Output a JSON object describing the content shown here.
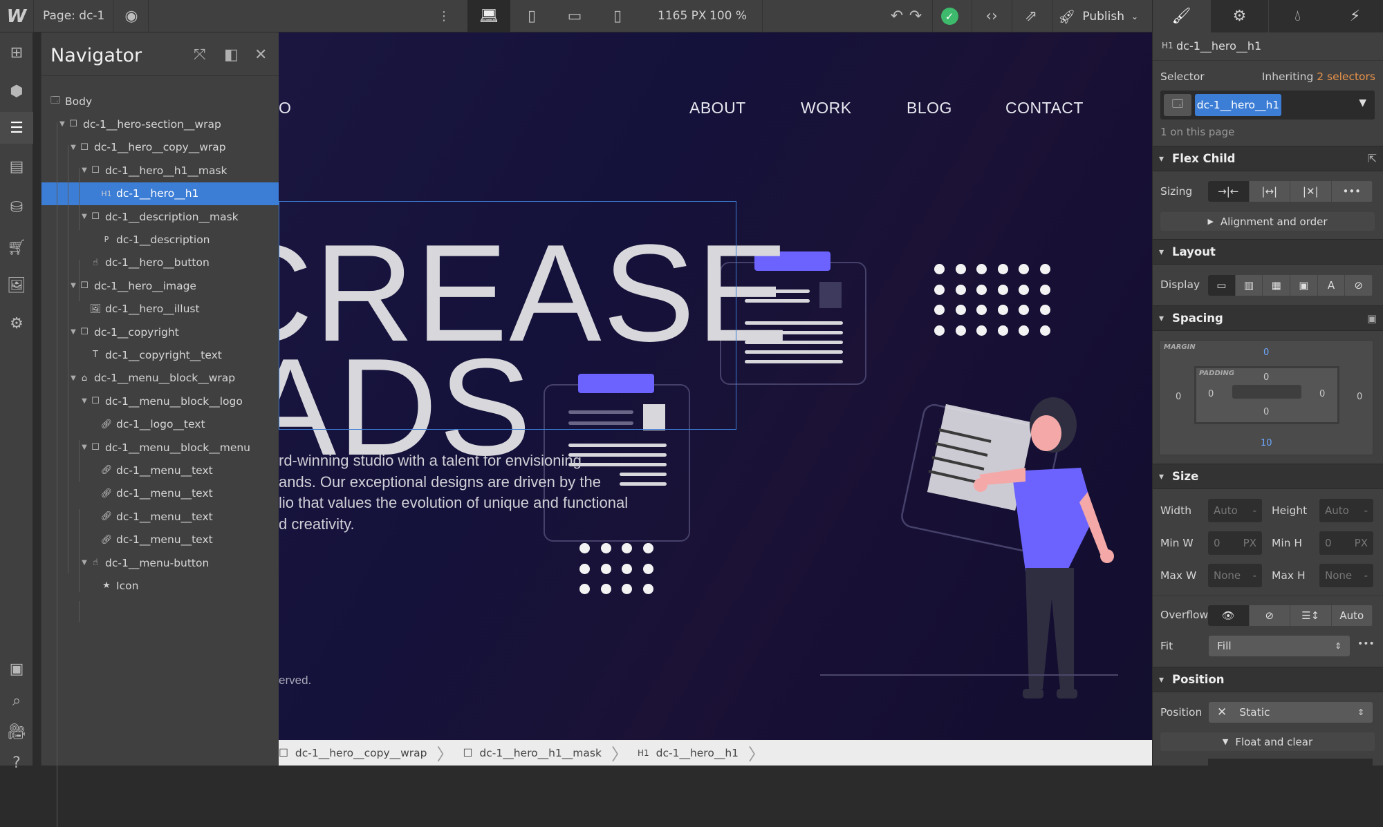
{
  "topbar": {
    "logo": "W",
    "page_label": "Page: dc-1",
    "canvas_width": "1165 PX",
    "zoom": "100 %",
    "publish_label": "Publish",
    "status_color": "#3dba6b"
  },
  "leftbar": {
    "icons": [
      "add-icon",
      "components-icon",
      "navigator-icon",
      "pages-icon",
      "cms-icon",
      "ecommerce-icon",
      "assets-icon",
      "settings-icon",
      "selection-icon",
      "search-icon",
      "video-tutorials-icon",
      "help-icon"
    ]
  },
  "navigator": {
    "title": "Navigator",
    "tree": [
      {
        "label": "Body",
        "depth": 0,
        "icon": "body",
        "caret": false
      },
      {
        "label": "dc-1__hero-section__wrap",
        "depth": 1,
        "icon": "box",
        "caret": true
      },
      {
        "label": "dc-1__hero__copy__wrap",
        "depth": 2,
        "icon": "box",
        "caret": true
      },
      {
        "label": "dc-1__hero__h1__mask",
        "depth": 3,
        "icon": "box",
        "caret": true
      },
      {
        "label": "dc-1__hero__h1",
        "depth": 4,
        "icon": "H1",
        "caret": false,
        "selected": true
      },
      {
        "label": "dc-1__description__mask",
        "depth": 3,
        "icon": "box",
        "caret": true
      },
      {
        "label": "dc-1__description",
        "depth": 4,
        "icon": "P",
        "caret": false
      },
      {
        "label": "dc-1__hero__button",
        "depth": 3,
        "icon": "hand",
        "caret": false
      },
      {
        "label": "dc-1__hero__image",
        "depth": 2,
        "icon": "box",
        "caret": true
      },
      {
        "label": "dc-1__hero__illust",
        "depth": 3,
        "icon": "image",
        "caret": false
      },
      {
        "label": "dc-1__copyright",
        "depth": 2,
        "icon": "box",
        "caret": true
      },
      {
        "label": "dc-1__copyright__text",
        "depth": 3,
        "icon": "text",
        "caret": false
      },
      {
        "label": "dc-1__menu__block__wrap",
        "depth": 2,
        "icon": "home",
        "caret": true
      },
      {
        "label": "dc-1__menu__block__logo",
        "depth": 3,
        "icon": "box",
        "caret": true
      },
      {
        "label": "dc-1__logo__text",
        "depth": 4,
        "icon": "link",
        "caret": false
      },
      {
        "label": "dc-1__menu__block__menu",
        "depth": 3,
        "icon": "box",
        "caret": true
      },
      {
        "label": "dc-1__menu__text",
        "depth": 4,
        "icon": "link",
        "caret": false
      },
      {
        "label": "dc-1__menu__text",
        "depth": 4,
        "icon": "link",
        "caret": false
      },
      {
        "label": "dc-1__menu__text",
        "depth": 4,
        "icon": "link",
        "caret": false
      },
      {
        "label": "dc-1__menu__text",
        "depth": 4,
        "icon": "link",
        "caret": false
      },
      {
        "label": "dc-1__menu-button",
        "depth": 3,
        "icon": "hand",
        "caret": true
      },
      {
        "label": "Icon",
        "depth": 4,
        "icon": "star",
        "caret": false
      }
    ]
  },
  "canvas": {
    "logo_fragment": "O",
    "nav": [
      "ABOUT",
      "WORK",
      "BLOG",
      "CONTACT"
    ],
    "hero_line1": "CREASE",
    "hero_line2": "ADS",
    "description": [
      "rd-winning studio with a talent for envisioning",
      "ands. Our exceptional designs are driven by the",
      "lio that values the evolution of unique and functional",
      "d creativity."
    ],
    "copyright_fragment": "erved.",
    "accent": "#6c63ff",
    "selection_color": "#3c7dd6"
  },
  "breadcrumb": [
    {
      "icon": "box",
      "label": "dc-1__hero__copy__wrap"
    },
    {
      "icon": "box",
      "label": "dc-1__hero__h1__mask"
    },
    {
      "icon": "H1",
      "label": "dc-1__hero__h1"
    }
  ],
  "right": {
    "tabs": [
      "style-icon",
      "settings-icon",
      "style-manager-icon",
      "interactions-icon"
    ],
    "element_tag": "H1",
    "element_name": "dc-1__hero__h1",
    "selector_label": "Selector",
    "inheriting": "Inheriting",
    "inheriting_count": "2 selectors",
    "selector_chip": "dc-1__hero__h1",
    "on_page": "1 on this page",
    "flex_child": {
      "title": "Flex Child",
      "sizing_label": "Sizing",
      "alignment": "Alignment and order"
    },
    "layout": {
      "title": "Layout",
      "display_label": "Display",
      "display_options": [
        "block",
        "flex",
        "grid",
        "inline-block",
        "inline",
        "none"
      ],
      "display_selected": "block"
    },
    "spacing": {
      "title": "Spacing",
      "margin_label": "MARGIN",
      "padding_label": "PADDING",
      "margin": {
        "top": "0",
        "right": "0",
        "bottom": "10",
        "left": "0"
      },
      "padding": {
        "top": "0",
        "right": "0",
        "bottom": "0",
        "left": "0"
      }
    },
    "size": {
      "title": "Size",
      "width_label": "Width",
      "width": "Auto",
      "height_label": "Height",
      "height": "Auto",
      "minw_label": "Min W",
      "minw": "0",
      "minh_label": "Min H",
      "minh": "0",
      "unit": "PX",
      "maxw_label": "Max W",
      "maxw": "None",
      "maxh_label": "Max H",
      "maxh": "None",
      "dash": "-",
      "overflow_label": "Overflow",
      "overflow_auto": "Auto",
      "fit_label": "Fit",
      "fit": "Fill"
    },
    "position": {
      "title": "Position",
      "position_label": "Position",
      "position": "Static",
      "float": "Float and clear"
    }
  }
}
